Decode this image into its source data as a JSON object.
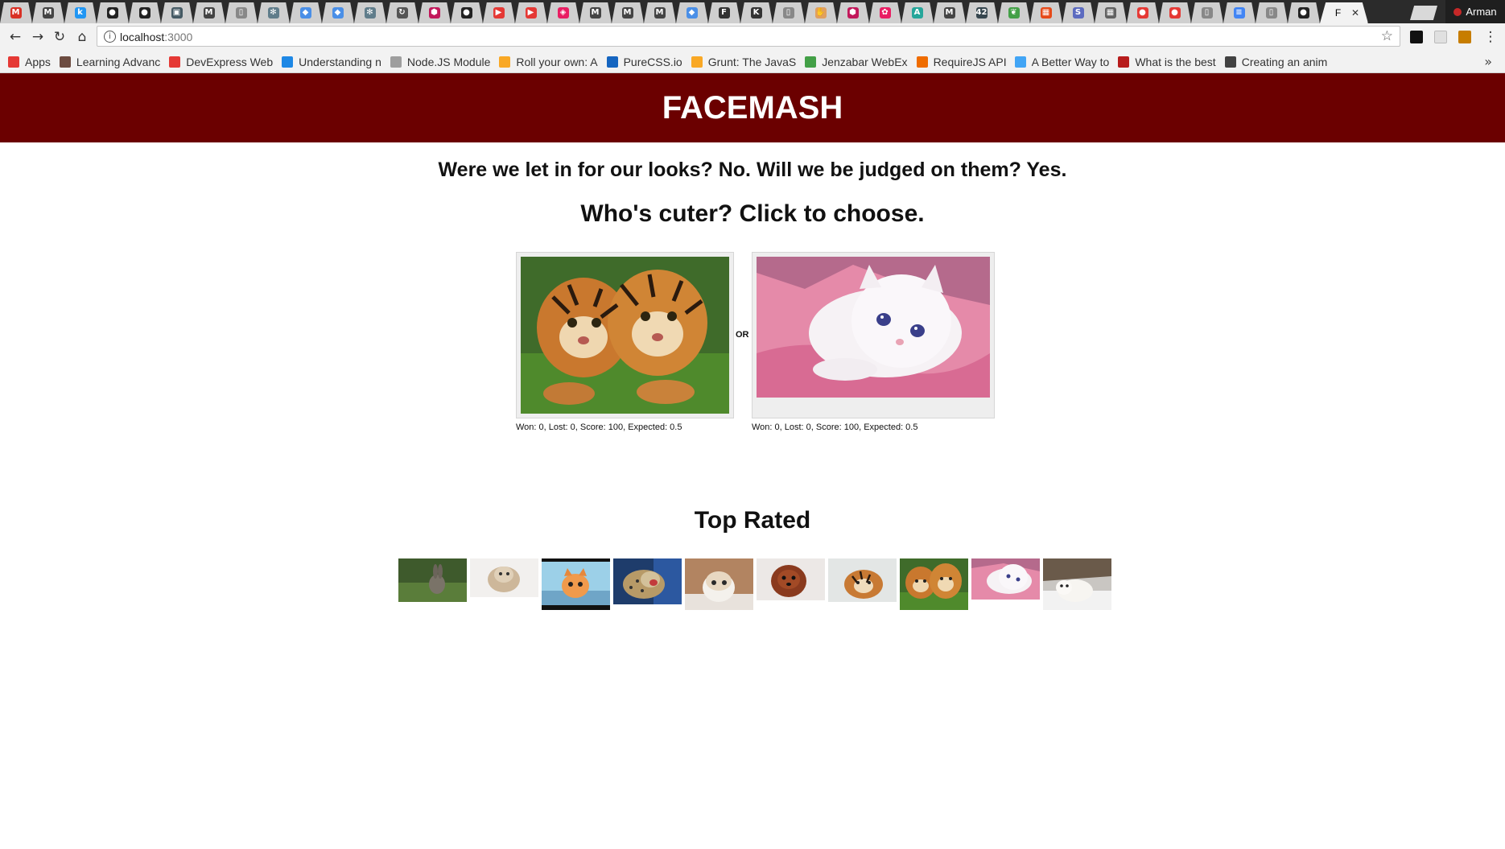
{
  "browser": {
    "profile_name": "Arman",
    "url_host": "localhost",
    "url_port": ":3000",
    "active_tab_label": "F",
    "tabs": [
      {
        "icon": "gmail-icon",
        "glyph": "M",
        "color": "#d93025"
      },
      {
        "icon": "medium-icon",
        "glyph": "M",
        "color": "#444444"
      },
      {
        "icon": "k-icon",
        "glyph": "k",
        "color": "#2196f3"
      },
      {
        "icon": "github-icon",
        "glyph": "●",
        "color": "#222222"
      },
      {
        "icon": "github-icon",
        "glyph": "●",
        "color": "#222222"
      },
      {
        "icon": "screen-icon",
        "glyph": "▣",
        "color": "#455a64"
      },
      {
        "icon": "medium-icon",
        "glyph": "M",
        "color": "#444444"
      },
      {
        "icon": "document-icon",
        "glyph": "▯",
        "color": "#888888"
      },
      {
        "icon": "react-icon",
        "glyph": "✻",
        "color": "#607d8b"
      },
      {
        "icon": "bookmark-icon",
        "glyph": "◆",
        "color": "#4a8fe7"
      },
      {
        "icon": "bookmark-icon",
        "glyph": "◆",
        "color": "#4a8fe7"
      },
      {
        "icon": "react-icon",
        "glyph": "✻",
        "color": "#607d8b"
      },
      {
        "icon": "refresh-icon",
        "glyph": "↻",
        "color": "#555555"
      },
      {
        "icon": "hexagon-icon",
        "glyph": "⬢",
        "color": "#c2185b"
      },
      {
        "icon": "github-icon",
        "glyph": "●",
        "color": "#222222"
      },
      {
        "icon": "youtube-icon",
        "glyph": "▶",
        "color": "#e53935"
      },
      {
        "icon": "youtube-icon",
        "glyph": "▶",
        "color": "#e53935"
      },
      {
        "icon": "shield-icon",
        "glyph": "◈",
        "color": "#e91e63"
      },
      {
        "icon": "medium-icon",
        "glyph": "M",
        "color": "#444444"
      },
      {
        "icon": "medium-icon",
        "glyph": "M",
        "color": "#444444"
      },
      {
        "icon": "medium-icon",
        "glyph": "M",
        "color": "#444444"
      },
      {
        "icon": "bookmark-icon",
        "glyph": "◆",
        "color": "#4a8fe7"
      },
      {
        "icon": "f-icon",
        "glyph": "F",
        "color": "#333333"
      },
      {
        "icon": "kh-icon",
        "glyph": "K",
        "color": "#333333"
      },
      {
        "icon": "document-icon",
        "glyph": "▯",
        "color": "#888888"
      },
      {
        "icon": "hand-icon",
        "glyph": "✋",
        "color": "#e0a060"
      },
      {
        "icon": "hexagon-icon",
        "glyph": "⬢",
        "color": "#c2185b"
      },
      {
        "icon": "gear-icon",
        "glyph": "✿",
        "color": "#e91e63"
      },
      {
        "icon": "a-icon",
        "glyph": "A",
        "color": "#26a69a"
      },
      {
        "icon": "medium-icon",
        "glyph": "M",
        "color": "#444444"
      },
      {
        "icon": "42-icon",
        "glyph": "42",
        "color": "#37474f"
      },
      {
        "icon": "leaf-icon",
        "glyph": "❦",
        "color": "#43a047"
      },
      {
        "icon": "grid-icon",
        "glyph": "▦",
        "color": "#e64a19"
      },
      {
        "icon": "s-icon",
        "glyph": "S",
        "color": "#5c6bc0"
      },
      {
        "icon": "tile-icon",
        "glyph": "▦",
        "color": "#616161"
      },
      {
        "icon": "circle-icon",
        "glyph": "●",
        "color": "#e53935"
      },
      {
        "icon": "circle-icon",
        "glyph": "●",
        "color": "#e53935"
      },
      {
        "icon": "document-icon",
        "glyph": "▯",
        "color": "#888888"
      },
      {
        "icon": "docs-icon",
        "glyph": "≡",
        "color": "#4285f4"
      },
      {
        "icon": "document-icon",
        "glyph": "▯",
        "color": "#888888"
      },
      {
        "icon": "github-icon",
        "glyph": "●",
        "color": "#222222"
      }
    ],
    "bookmarks": [
      {
        "icon": "apps-icon",
        "label": "Apps",
        "color": "#e53935",
        "width": 32
      },
      {
        "icon": "avatar-icon",
        "label": "Learning Advanc",
        "color": "#6d4c41",
        "width": 112
      },
      {
        "icon": "youtube-icon",
        "label": "DevExpress Web",
        "color": "#e53935",
        "width": 108
      },
      {
        "icon": "javascript-icon",
        "label": "Understanding n",
        "color": "#1e88e5",
        "width": 112
      },
      {
        "icon": "document-icon",
        "label": "Node.JS Module",
        "color": "#9e9e9e",
        "width": 112
      },
      {
        "icon": "ninja-icon",
        "label": "Roll your own: A",
        "color": "#f9a825",
        "width": 112
      },
      {
        "icon": "purecss-icon",
        "label": "PureCSS.io",
        "color": "#1565c0",
        "width": 74
      },
      {
        "icon": "grunt-icon",
        "label": "Grunt: The JavaS",
        "color": "#f9a825",
        "width": 112
      },
      {
        "icon": "jenzabar-icon",
        "label": "Jenzabar WebEx",
        "color": "#43a047",
        "width": 112
      },
      {
        "icon": "requirejs-icon",
        "label": "RequireJS API",
        "color": "#ef6c00",
        "width": 90
      },
      {
        "icon": "bookmark-icon",
        "label": "A Better Way to",
        "color": "#42a5f5",
        "width": 108
      },
      {
        "icon": "quora-icon",
        "label": "What is the best",
        "color": "#b71c1c",
        "width": 112
      },
      {
        "icon": "page-icon",
        "label": "Creating an anim",
        "color": "#424242",
        "width": 112
      }
    ]
  },
  "page": {
    "title": "FACEMASH",
    "tagline": "Were we let in for our looks? No. Will we be judged on them? Yes.",
    "prompt": "Who's cuter? Click to choose.",
    "or_label": "OR",
    "left_candidate": {
      "image": "tiger-cubs-photo",
      "stats": "Won: 0, Lost: 0, Score: 100, Expected: 0.5"
    },
    "right_candidate": {
      "image": "white-kitten-photo",
      "stats": "Won: 0, Lost: 0, Score: 100, Expected: 0.5"
    },
    "top_rated_title": "Top Rated",
    "top_rated": [
      {
        "name": "bunny-thumbnail"
      },
      {
        "name": "fluffy-kitten-thumbnail"
      },
      {
        "name": "orange-kitten-thumbnail"
      },
      {
        "name": "leopard-cub-thumbnail"
      },
      {
        "name": "cream-kitten-thumbnail"
      },
      {
        "name": "puppy-thumbnail"
      },
      {
        "name": "tiger-cub-thumbnail"
      },
      {
        "name": "tiger-cubs-thumbnail"
      },
      {
        "name": "white-kitten-thumbnail"
      },
      {
        "name": "polar-bear-cub-thumbnail"
      }
    ]
  },
  "colors": {
    "header_bg": "#6b0000",
    "header_text": "#ffffff"
  }
}
